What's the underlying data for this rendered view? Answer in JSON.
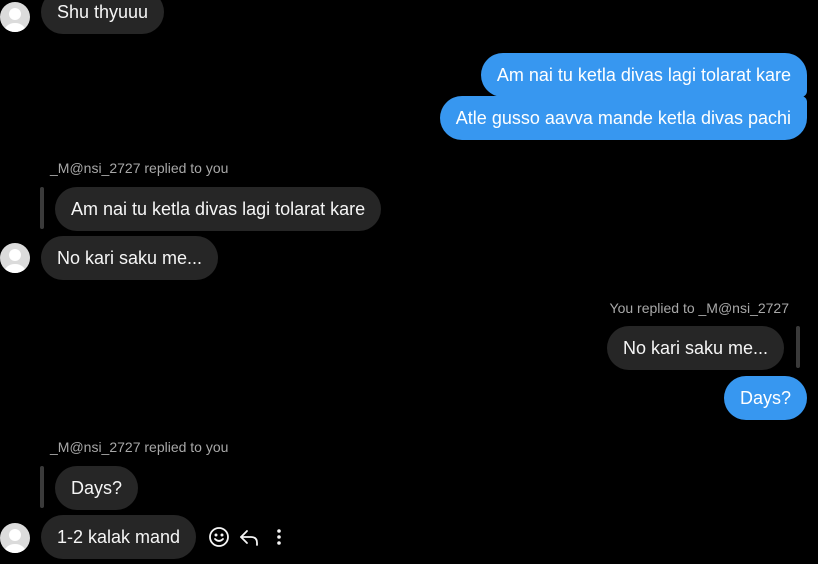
{
  "conversation": {
    "messages": {
      "m1": {
        "text": "Shu thyuuu"
      },
      "m2": {
        "text": "Am nai tu ketla divas lagi tolarat kare"
      },
      "m3": {
        "text": "Atle gusso aavva mande ketla divas pachi"
      },
      "r1": {
        "label": "_M@nsi_2727 replied to you",
        "quoted_text": "Am nai tu ketla divas lagi tolarat kare",
        "text": "No kari saku me..."
      },
      "r2": {
        "label": "You replied to _M@nsi_2727",
        "quoted_text": "No kari saku me...",
        "text": "Days?"
      },
      "r3": {
        "label": "_M@nsi_2727 replied to you",
        "quoted_text": "Days?",
        "text": "1-2 kalak mand"
      }
    }
  },
  "message_actions": {
    "react_icon": "smiley-icon",
    "reply_icon": "reply-arrow-icon",
    "more_icon": "more-vertical-icon"
  },
  "colors": {
    "background": "#000000",
    "incoming_bubble": "#262626",
    "outgoing_bubble": "#3797f0",
    "meta_text": "#a8a8a8"
  }
}
